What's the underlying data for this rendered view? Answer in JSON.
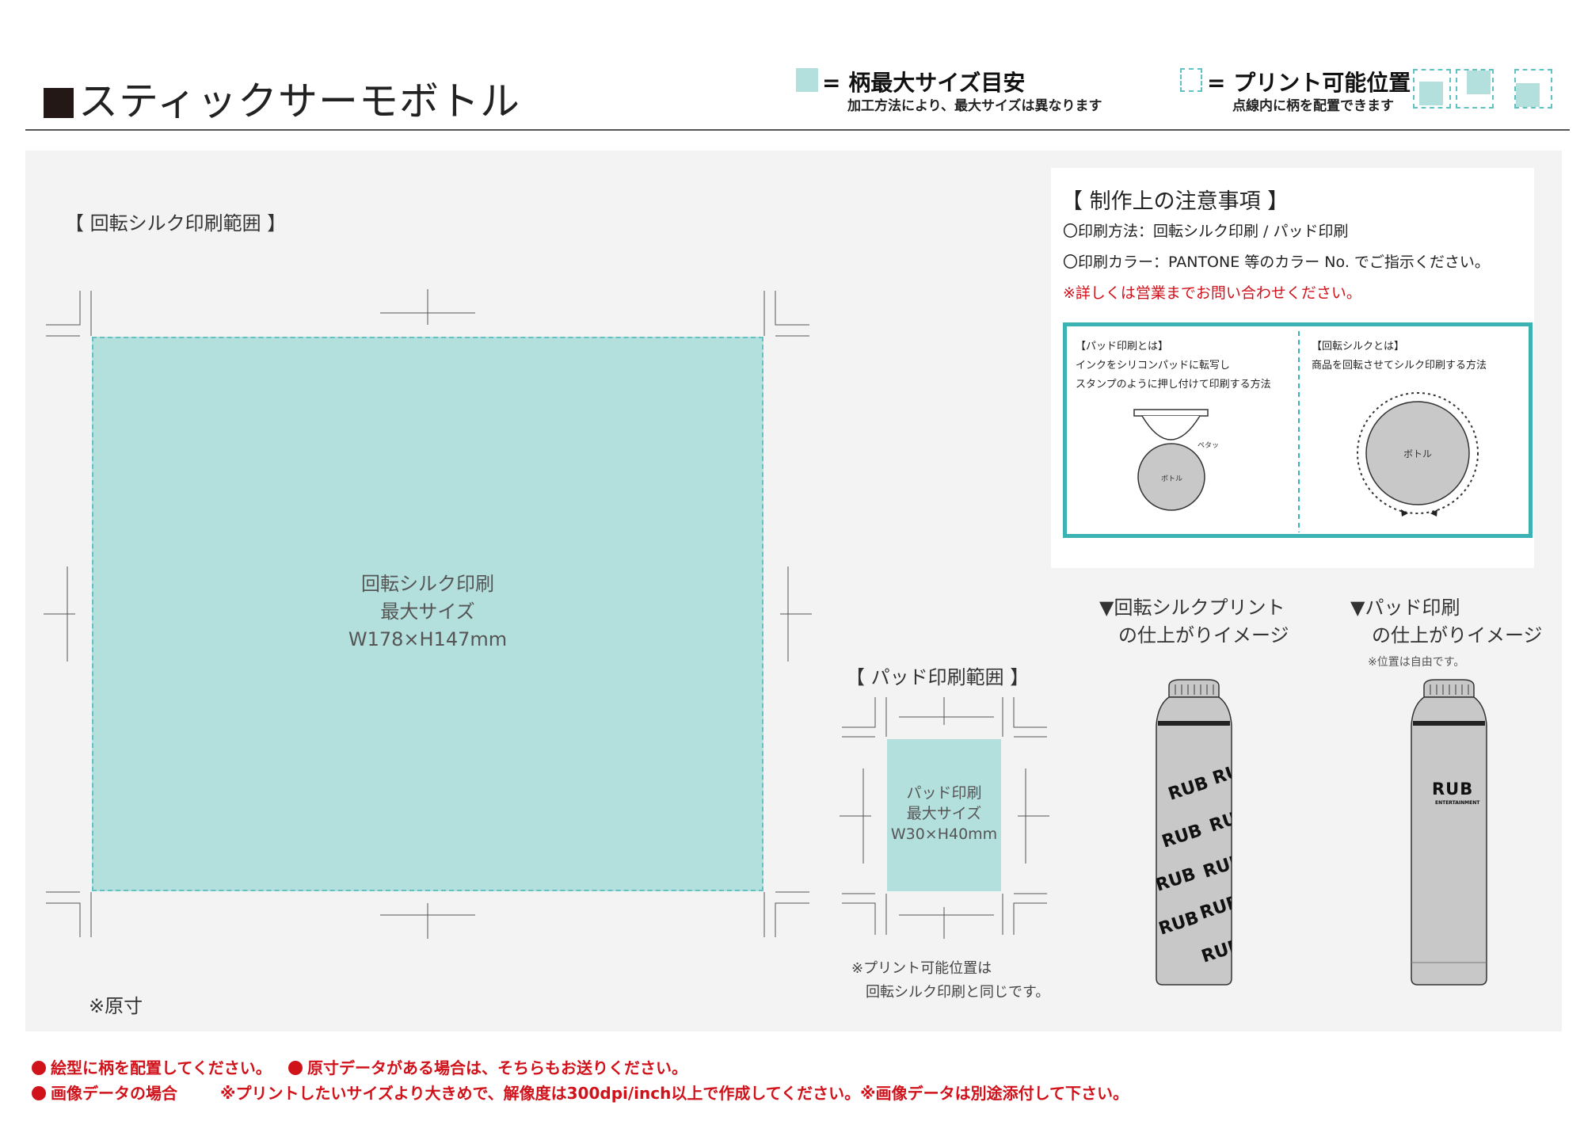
{
  "header": {
    "title": "スティックサーモボトル",
    "legend_max": {
      "title": "= 柄最大サイズ目安",
      "sub": "加工方法により、最大サイズは異なります"
    },
    "legend_print": {
      "title": "= プリント可能位置",
      "sub": "点線内に柄を配置できます"
    }
  },
  "silk": {
    "section_title": "【 回転シルク印刷範囲 】",
    "label_1": "回転シルク印刷",
    "label_2": "最大サイズ",
    "label_3": "W178×H147mm",
    "actual_size": "※原寸"
  },
  "pad": {
    "section_title": "【 パッド印刷範囲 】",
    "label_1": "パッド印刷",
    "label_2": "最大サイズ",
    "label_3": "W30×H40mm",
    "note_1": "※プリント可能位置は",
    "note_2": "回転シルク印刷と同じです。"
  },
  "notes": {
    "title": "【 制作上の注意事項 】",
    "method": "〇印刷方法：回転シルク印刷 / パッド印刷",
    "color": "〇印刷カラー：PANTONE 等のカラー No. でご指示ください。",
    "red": "※詳しくは営業までお問い合わせください。",
    "pad_head": "【パッド印刷とは】",
    "pad_desc_1": "インクをシリコンパッドに転写し",
    "pad_desc_2": "スタンプのように押し付けて印刷する方法",
    "silk_head": "【回転シルクとは】",
    "silk_desc": "商品を回転させてシルク印刷する方法",
    "bottle_label": "ボトル",
    "beta_label": "ペタッ"
  },
  "images": {
    "silk_title_1": "▼回転シルクプリント",
    "silk_title_2": "の仕上がりイメージ",
    "pad_title_1": "▼パッド印刷",
    "pad_title_2": "の仕上がりイメージ",
    "pad_note": "※位置は自由です。",
    "logo_text": "RUB",
    "logo_sub": "ENTERTAINMENT"
  },
  "footer": {
    "line1_a": "絵型に柄を配置してください。",
    "line1_b": "原寸データがある場合は、そちらもお送りください。",
    "line2_a": "画像データの場合",
    "line2_b": "※プリントしたいサイズより大きめで、解像度は300dpi/inch以上で作成してください。※画像データは別途添付して下さい。"
  },
  "colors": {
    "area_fill": "#b3dfdd",
    "dash": "#62c2c3",
    "frame_teal": "#3bb3b5",
    "alert_red": "#d0121b",
    "bottle_gray": "#c8c8c8"
  }
}
